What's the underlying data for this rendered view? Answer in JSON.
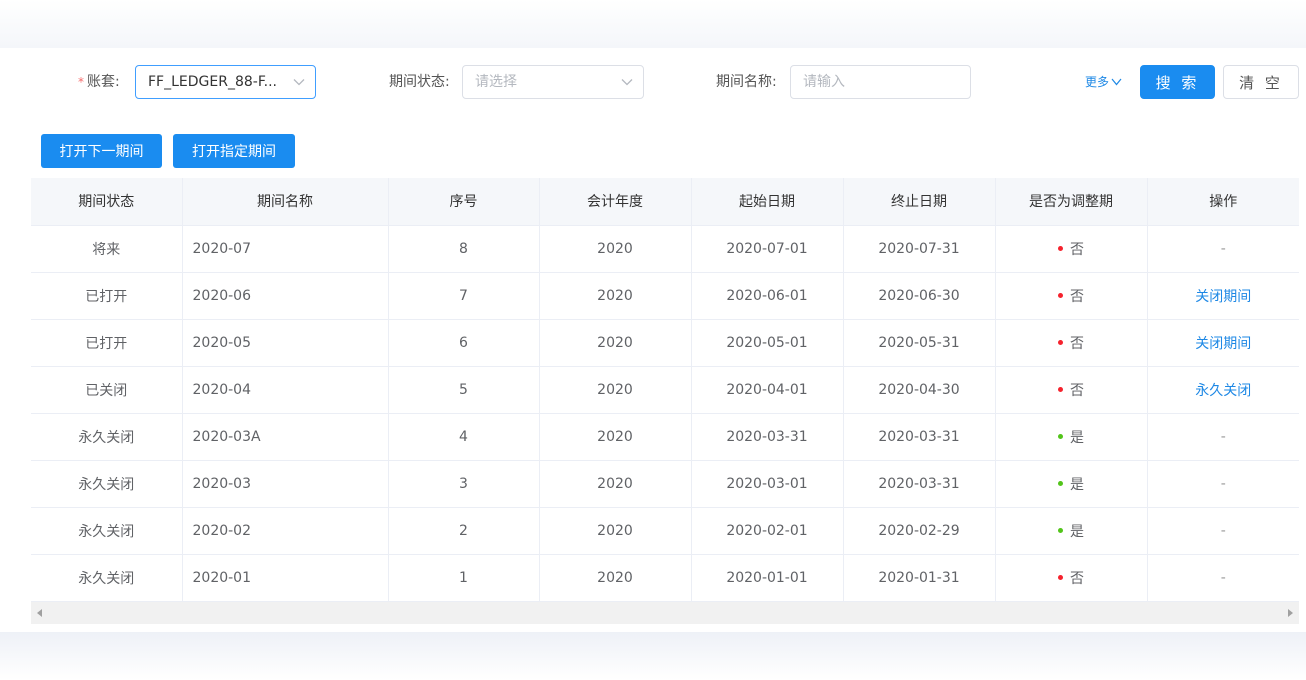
{
  "filters": {
    "ledger": {
      "label": "账套:",
      "value": "FF_LEDGER_88-F..."
    },
    "period_status": {
      "label": "期间状态:",
      "placeholder": "请选择"
    },
    "period_name": {
      "label": "期间名称:",
      "placeholder": "请输入"
    },
    "more_label": "更多",
    "search_label": "搜 索",
    "clear_label": "清 空"
  },
  "actions": {
    "open_next_label": "打开下一期间",
    "open_specific_label": "打开指定期间"
  },
  "table": {
    "columns": [
      "期间状态",
      "期间名称",
      "序号",
      "会计年度",
      "起始日期",
      "终止日期",
      "是否为调整期",
      "操作"
    ],
    "rows": [
      {
        "status": "将来",
        "name": "2020-07",
        "seq": "8",
        "year": "2020",
        "start": "2020-07-01",
        "end": "2020-07-31",
        "adjust": "否",
        "op": "-"
      },
      {
        "status": "已打开",
        "name": "2020-06",
        "seq": "7",
        "year": "2020",
        "start": "2020-06-01",
        "end": "2020-06-30",
        "adjust": "否",
        "op": "关闭期间"
      },
      {
        "status": "已打开",
        "name": "2020-05",
        "seq": "6",
        "year": "2020",
        "start": "2020-05-01",
        "end": "2020-05-31",
        "adjust": "否",
        "op": "关闭期间"
      },
      {
        "status": "已关闭",
        "name": "2020-04",
        "seq": "5",
        "year": "2020",
        "start": "2020-04-01",
        "end": "2020-04-30",
        "adjust": "否",
        "op": "永久关闭"
      },
      {
        "status": "永久关闭",
        "name": "2020-03A",
        "seq": "4",
        "year": "2020",
        "start": "2020-03-31",
        "end": "2020-03-31",
        "adjust": "是",
        "op": "-"
      },
      {
        "status": "永久关闭",
        "name": "2020-03",
        "seq": "3",
        "year": "2020",
        "start": "2020-03-01",
        "end": "2020-03-31",
        "adjust": "是",
        "op": "-"
      },
      {
        "status": "永久关闭",
        "name": "2020-02",
        "seq": "2",
        "year": "2020",
        "start": "2020-02-01",
        "end": "2020-02-29",
        "adjust": "是",
        "op": "-"
      },
      {
        "status": "永久关闭",
        "name": "2020-01",
        "seq": "1",
        "year": "2020",
        "start": "2020-01-01",
        "end": "2020-01-31",
        "adjust": "否",
        "op": "-"
      }
    ]
  },
  "colors": {
    "primary": "#1a8cf0",
    "link": "#1e88e5",
    "dot_no": "#f5222d",
    "dot_yes": "#52c41a"
  },
  "icons": {
    "select_arrow": "chevron-down-icon",
    "scroll_left": "caret-left-icon",
    "scroll_right": "caret-right-icon"
  }
}
